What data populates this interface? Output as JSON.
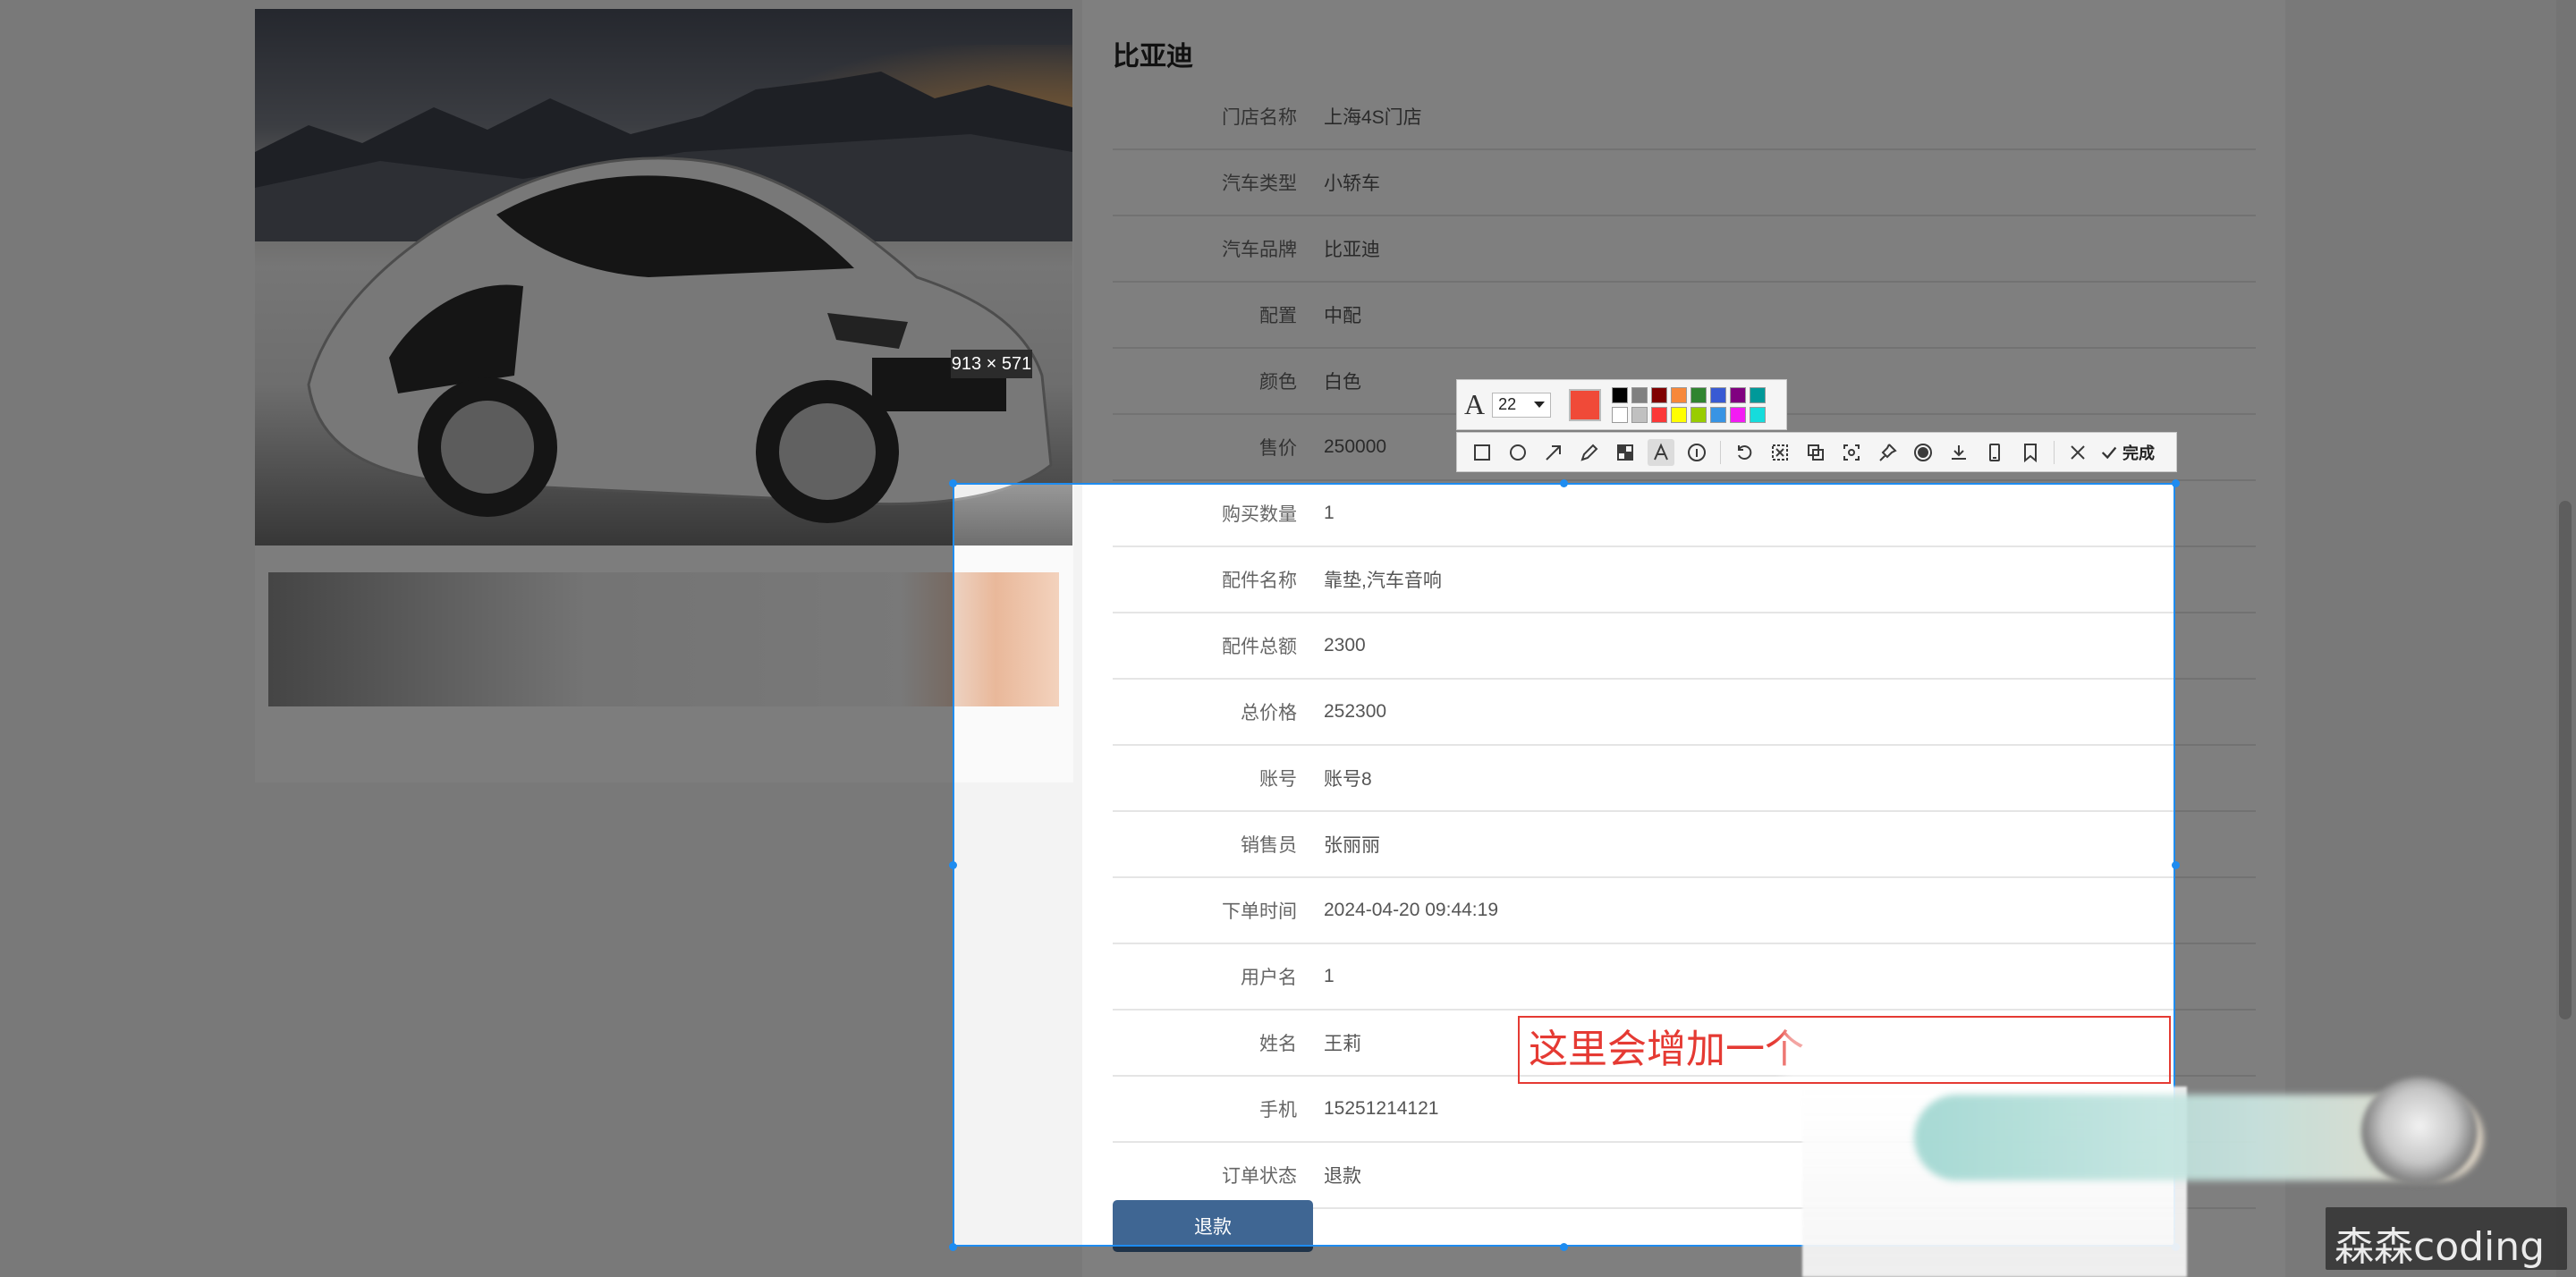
{
  "detail": {
    "title": "比亚迪",
    "fields": [
      {
        "label": "门店名称",
        "value": "上海4S门店"
      },
      {
        "label": "汽车类型",
        "value": "小轿车"
      },
      {
        "label": "汽车品牌",
        "value": "比亚迪"
      },
      {
        "label": "配置",
        "value": "中配"
      },
      {
        "label": "颜色",
        "value": "白色"
      },
      {
        "label": "售价",
        "value": "250000"
      },
      {
        "label": "购买数量",
        "value": "1"
      },
      {
        "label": "配件名称",
        "value": "靠垫,汽车音响"
      },
      {
        "label": "配件总额",
        "value": "2300"
      },
      {
        "label": "总价格",
        "value": "252300"
      },
      {
        "label": "账号",
        "value": "账号8"
      },
      {
        "label": "销售员",
        "value": "张丽丽"
      },
      {
        "label": "下单时间",
        "value": "2024-04-20 09:44:19"
      },
      {
        "label": "用户名",
        "value": "1"
      },
      {
        "label": "姓名",
        "value": "王莉"
      },
      {
        "label": "手机",
        "value": "15251214121"
      },
      {
        "label": "订单状态",
        "value": "退款"
      }
    ],
    "refund_button": "退款"
  },
  "capture_tool": {
    "selection_size": "913 × 571",
    "font_size": "22",
    "current_color": "#f04a38",
    "palette": [
      "#000000",
      "#808080",
      "#800000",
      "#f7883a",
      "#308430",
      "#385ad3",
      "#800080",
      "#009999",
      "#ffffff",
      "#c0c0c0",
      "#fb3838",
      "#ffff00",
      "#99cc00",
      "#3894e4",
      "#f31bf3",
      "#16dcdc"
    ],
    "tools": [
      "rectangle-icon",
      "ellipse-icon",
      "arrow-icon",
      "pen-icon",
      "mosaic-icon",
      "text-icon",
      "number-icon",
      "undo-icon",
      "cut-icon",
      "copy-icon",
      "pin-screen-icon",
      "pin-icon",
      "record-icon",
      "download-icon",
      "phone-icon",
      "bookmark-icon",
      "close-icon"
    ],
    "done_label": "完成",
    "annotation_text": "这里会增加一个"
  },
  "watermark": "森森coding",
  "colors": {
    "accent": "#1e8cf0",
    "button": "#3f6693",
    "annotation": "#e53a33"
  }
}
